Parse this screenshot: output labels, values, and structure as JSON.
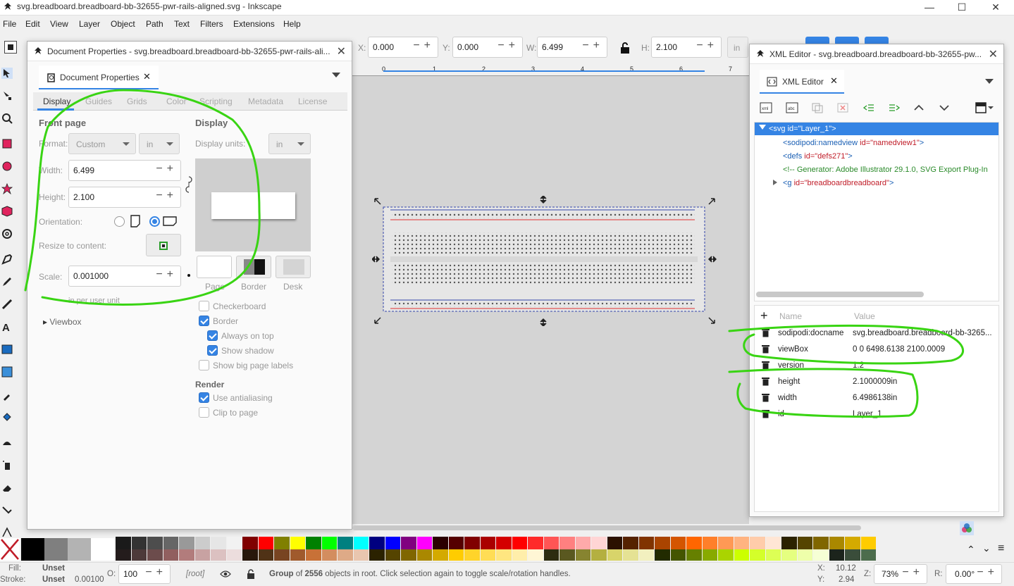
{
  "window": {
    "title": "svg.breadboard.breadboard-bb-32655-pwr-rails-aligned.svg - Inkscape",
    "minimize": "—",
    "maximize": "☐",
    "close": "✕"
  },
  "menu": [
    "File",
    "Edit",
    "View",
    "Layer",
    "Object",
    "Path",
    "Text",
    "Filters",
    "Extensions",
    "Help"
  ],
  "toolbar": {
    "x_label": "X:",
    "x_value": "0.000",
    "y_label": "Y:",
    "y_value": "0.000",
    "w_label": "W:",
    "w_value": "6.499",
    "h_label": "H:",
    "h_value": "2.100",
    "unit": "in"
  },
  "ruler": {
    "ticks": [
      "0",
      "1",
      "2",
      "3",
      "4",
      "5",
      "6",
      "7"
    ]
  },
  "doc_props": {
    "title": "Document Properties - svg.breadboard.breadboard-bb-32655-pwr-rails-ali...",
    "tab_label": "Document Properties",
    "tabs": [
      "Display",
      "Guides",
      "Grids",
      "Color",
      "Scripting",
      "Metadata",
      "License"
    ],
    "front_page": "Front page",
    "format_label": "Format:",
    "format_value": "Custom",
    "format_unit": "in",
    "width_label": "Width:",
    "width_value": "6.499",
    "height_label": "Height:",
    "height_value": "2.100",
    "orientation_label": "Orientation:",
    "resize_label": "Resize to content:",
    "scale_label": "Scale:",
    "scale_value": "0.001000",
    "per_user_unit": "in per user unit",
    "viewbox": "Viewbox",
    "display_header": "Display",
    "display_units_label": "Display units:",
    "display_units_value": "in",
    "color_labels": [
      "Page",
      "Border",
      "Desk"
    ],
    "checkboxes": [
      {
        "label": "Checkerboard",
        "checked": false
      },
      {
        "label": "Border",
        "checked": true
      },
      {
        "label": "Always on top",
        "checked": true
      },
      {
        "label": "Show shadow",
        "checked": true
      },
      {
        "label": "Show big page labels",
        "checked": false
      }
    ],
    "render_header": "Render",
    "render_checkboxes": [
      {
        "label": "Use antialiasing",
        "checked": true
      },
      {
        "label": "Clip to page",
        "checked": false
      }
    ]
  },
  "xml_editor": {
    "title": "XML Editor - svg.breadboard.breadboard-bb-32655-pw...",
    "tab_label": "XML Editor",
    "nodes": [
      {
        "text": "<svg id=\"Layer_1\">"
      },
      {
        "tag": "<sodipodi:namedview ",
        "attr": "id=",
        "val": "\"namedview1\"",
        "end": ">"
      },
      {
        "tag": "<defs ",
        "attr": "id=",
        "val": "\"defs271\"",
        "end": ">"
      },
      {
        "comment": "<!-- Generator: Adobe Illustrator 29.1.0, SVG Export Plug-In"
      },
      {
        "tag": "<g ",
        "attr": "id=",
        "val": "\"breadboardbreadboard\"",
        "end": ">"
      }
    ],
    "col_name": "Name",
    "col_value": "Value",
    "attributes": [
      {
        "name": "sodipodi:docname",
        "value": "svg.breadboard.breadboard-bb-3265..."
      },
      {
        "name": "viewBox",
        "value": "0 0 6498.6138 2100.0009"
      },
      {
        "name": "version",
        "value": "1.2"
      },
      {
        "name": "height",
        "value": "2.1000009in"
      },
      {
        "name": "width",
        "value": "6.4986138in"
      },
      {
        "name": "id",
        "value": "Layer_1"
      }
    ]
  },
  "status": {
    "fill_label": "Fill:",
    "fill_value": "Unset",
    "stroke_label": "Stroke:",
    "stroke_value": "Unset",
    "stroke_width": "0.00100",
    "opacity_label": "O:",
    "opacity_value": "100",
    "layer": "[root]",
    "message_pre": "Group",
    "message_mid": " of ",
    "message_count": "2556",
    "message_post": " objects in root. Click selection again to toggle scale/rotation handles.",
    "x_label": "X:",
    "x_value": "10.12",
    "y_label": "Y:",
    "y_value": "2.94",
    "zoom_label": "Z:",
    "zoom_value": "73%",
    "rot_label": "R:",
    "rot_value": "0.00°"
  },
  "colors": {
    "accent": "#3584e4",
    "annotation": "#39d413"
  }
}
